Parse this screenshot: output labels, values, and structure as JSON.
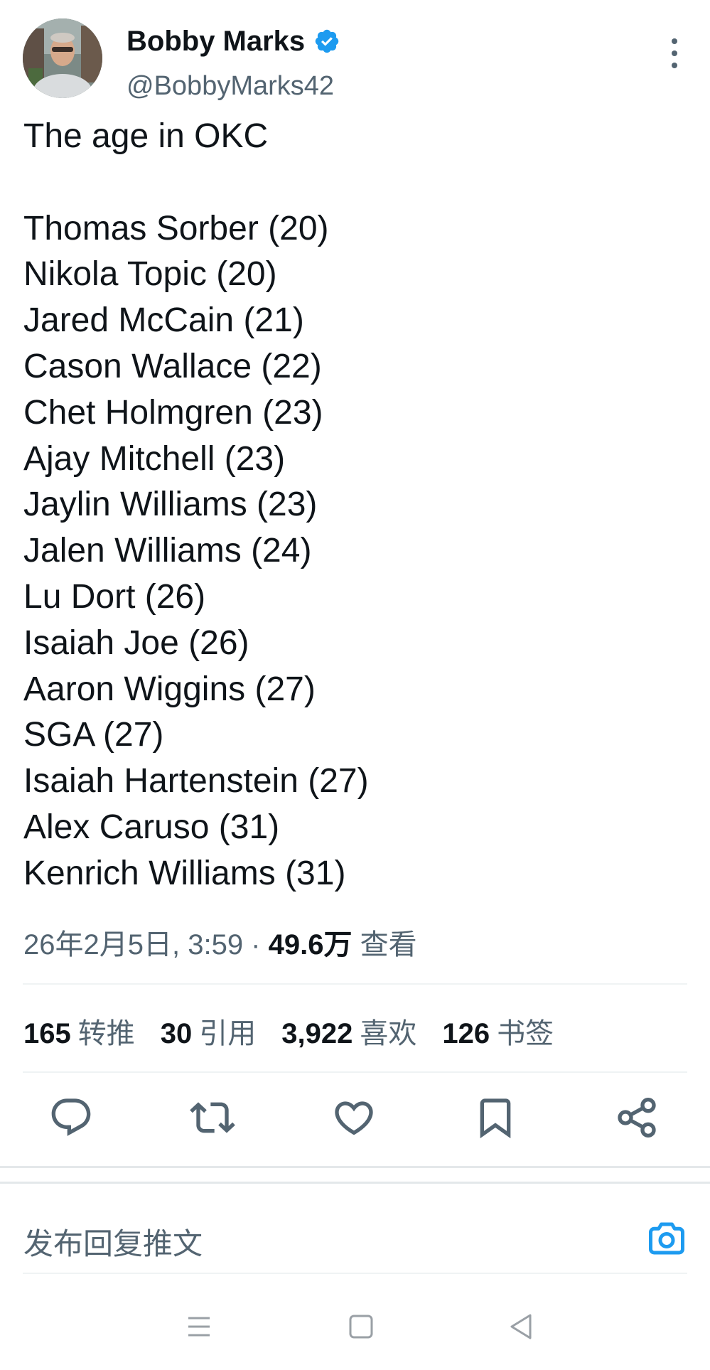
{
  "author": {
    "name": "Bobby Marks",
    "handle": "@BobbyMarks42",
    "verified_color": "#1d9bf0"
  },
  "tweet": {
    "lines": [
      "The age in OKC",
      "",
      "Thomas Sorber (20)",
      "Nikola Topic (20)",
      "Jared McCain (21)",
      "Cason Wallace (22)",
      "Chet Holmgren (23)",
      "Ajay Mitchell (23)",
      "Jaylin Williams (23)",
      "Jalen Williams (24)",
      "Lu Dort (26)",
      "Isaiah Joe (26)",
      "Aaron Wiggins (27)",
      "SGA (27)",
      "Isaiah Hartenstein (27)",
      "Alex Caruso (31)",
      "Kenrich Williams (31)"
    ]
  },
  "meta": {
    "timestamp": "26年2月5日, 3:59",
    "separator": " · ",
    "views_count": "49.6万",
    "views_label": "查看"
  },
  "stats": [
    {
      "count": "165",
      "label": "转推"
    },
    {
      "count": "30",
      "label": "引用"
    },
    {
      "count": "3,922",
      "label": "喜欢"
    },
    {
      "count": "126",
      "label": "书签"
    }
  ],
  "actions": [
    {
      "name": "reply-icon"
    },
    {
      "name": "retweet-icon"
    },
    {
      "name": "like-icon"
    },
    {
      "name": "bookmark-icon"
    },
    {
      "name": "share-icon"
    }
  ],
  "reply": {
    "placeholder": "发布回复推文",
    "camera_icon": "camera-icon",
    "accent_color": "#1d9bf0"
  },
  "system_nav": [
    {
      "name": "recents-menu-icon"
    },
    {
      "name": "home-square-icon"
    },
    {
      "name": "back-triangle-icon"
    }
  ]
}
